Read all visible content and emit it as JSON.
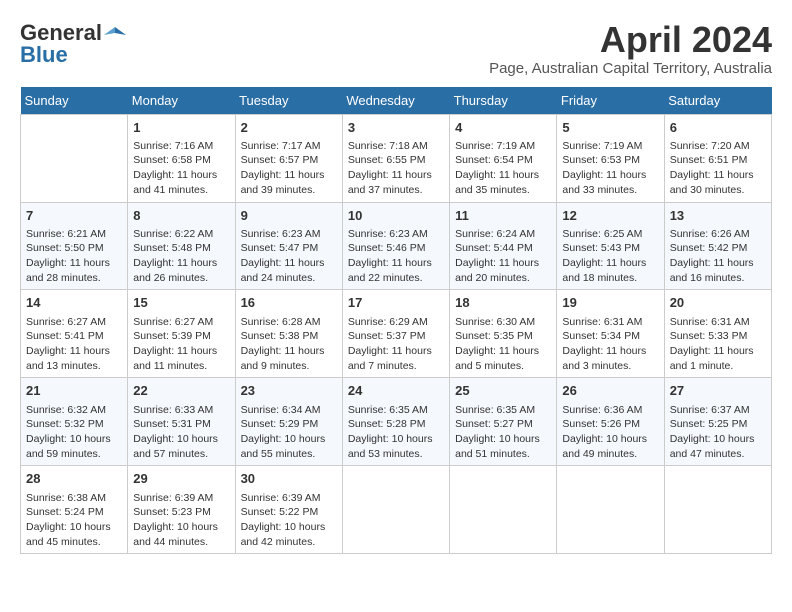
{
  "header": {
    "logo_general": "General",
    "logo_blue": "Blue",
    "month_title": "April 2024",
    "location": "Page, Australian Capital Territory, Australia"
  },
  "days_of_week": [
    "Sunday",
    "Monday",
    "Tuesday",
    "Wednesday",
    "Thursday",
    "Friday",
    "Saturday"
  ],
  "weeks": [
    [
      {
        "day": "",
        "info": ""
      },
      {
        "day": "1",
        "info": "Sunrise: 7:16 AM\nSunset: 6:58 PM\nDaylight: 11 hours\nand 41 minutes."
      },
      {
        "day": "2",
        "info": "Sunrise: 7:17 AM\nSunset: 6:57 PM\nDaylight: 11 hours\nand 39 minutes."
      },
      {
        "day": "3",
        "info": "Sunrise: 7:18 AM\nSunset: 6:55 PM\nDaylight: 11 hours\nand 37 minutes."
      },
      {
        "day": "4",
        "info": "Sunrise: 7:19 AM\nSunset: 6:54 PM\nDaylight: 11 hours\nand 35 minutes."
      },
      {
        "day": "5",
        "info": "Sunrise: 7:19 AM\nSunset: 6:53 PM\nDaylight: 11 hours\nand 33 minutes."
      },
      {
        "day": "6",
        "info": "Sunrise: 7:20 AM\nSunset: 6:51 PM\nDaylight: 11 hours\nand 30 minutes."
      }
    ],
    [
      {
        "day": "7",
        "info": "Sunrise: 6:21 AM\nSunset: 5:50 PM\nDaylight: 11 hours\nand 28 minutes."
      },
      {
        "day": "8",
        "info": "Sunrise: 6:22 AM\nSunset: 5:48 PM\nDaylight: 11 hours\nand 26 minutes."
      },
      {
        "day": "9",
        "info": "Sunrise: 6:23 AM\nSunset: 5:47 PM\nDaylight: 11 hours\nand 24 minutes."
      },
      {
        "day": "10",
        "info": "Sunrise: 6:23 AM\nSunset: 5:46 PM\nDaylight: 11 hours\nand 22 minutes."
      },
      {
        "day": "11",
        "info": "Sunrise: 6:24 AM\nSunset: 5:44 PM\nDaylight: 11 hours\nand 20 minutes."
      },
      {
        "day": "12",
        "info": "Sunrise: 6:25 AM\nSunset: 5:43 PM\nDaylight: 11 hours\nand 18 minutes."
      },
      {
        "day": "13",
        "info": "Sunrise: 6:26 AM\nSunset: 5:42 PM\nDaylight: 11 hours\nand 16 minutes."
      }
    ],
    [
      {
        "day": "14",
        "info": "Sunrise: 6:27 AM\nSunset: 5:41 PM\nDaylight: 11 hours\nand 13 minutes."
      },
      {
        "day": "15",
        "info": "Sunrise: 6:27 AM\nSunset: 5:39 PM\nDaylight: 11 hours\nand 11 minutes."
      },
      {
        "day": "16",
        "info": "Sunrise: 6:28 AM\nSunset: 5:38 PM\nDaylight: 11 hours\nand 9 minutes."
      },
      {
        "day": "17",
        "info": "Sunrise: 6:29 AM\nSunset: 5:37 PM\nDaylight: 11 hours\nand 7 minutes."
      },
      {
        "day": "18",
        "info": "Sunrise: 6:30 AM\nSunset: 5:35 PM\nDaylight: 11 hours\nand 5 minutes."
      },
      {
        "day": "19",
        "info": "Sunrise: 6:31 AM\nSunset: 5:34 PM\nDaylight: 11 hours\nand 3 minutes."
      },
      {
        "day": "20",
        "info": "Sunrise: 6:31 AM\nSunset: 5:33 PM\nDaylight: 11 hours\nand 1 minute."
      }
    ],
    [
      {
        "day": "21",
        "info": "Sunrise: 6:32 AM\nSunset: 5:32 PM\nDaylight: 10 hours\nand 59 minutes."
      },
      {
        "day": "22",
        "info": "Sunrise: 6:33 AM\nSunset: 5:31 PM\nDaylight: 10 hours\nand 57 minutes."
      },
      {
        "day": "23",
        "info": "Sunrise: 6:34 AM\nSunset: 5:29 PM\nDaylight: 10 hours\nand 55 minutes."
      },
      {
        "day": "24",
        "info": "Sunrise: 6:35 AM\nSunset: 5:28 PM\nDaylight: 10 hours\nand 53 minutes."
      },
      {
        "day": "25",
        "info": "Sunrise: 6:35 AM\nSunset: 5:27 PM\nDaylight: 10 hours\nand 51 minutes."
      },
      {
        "day": "26",
        "info": "Sunrise: 6:36 AM\nSunset: 5:26 PM\nDaylight: 10 hours\nand 49 minutes."
      },
      {
        "day": "27",
        "info": "Sunrise: 6:37 AM\nSunset: 5:25 PM\nDaylight: 10 hours\nand 47 minutes."
      }
    ],
    [
      {
        "day": "28",
        "info": "Sunrise: 6:38 AM\nSunset: 5:24 PM\nDaylight: 10 hours\nand 45 minutes."
      },
      {
        "day": "29",
        "info": "Sunrise: 6:39 AM\nSunset: 5:23 PM\nDaylight: 10 hours\nand 44 minutes."
      },
      {
        "day": "30",
        "info": "Sunrise: 6:39 AM\nSunset: 5:22 PM\nDaylight: 10 hours\nand 42 minutes."
      },
      {
        "day": "",
        "info": ""
      },
      {
        "day": "",
        "info": ""
      },
      {
        "day": "",
        "info": ""
      },
      {
        "day": "",
        "info": ""
      }
    ]
  ]
}
